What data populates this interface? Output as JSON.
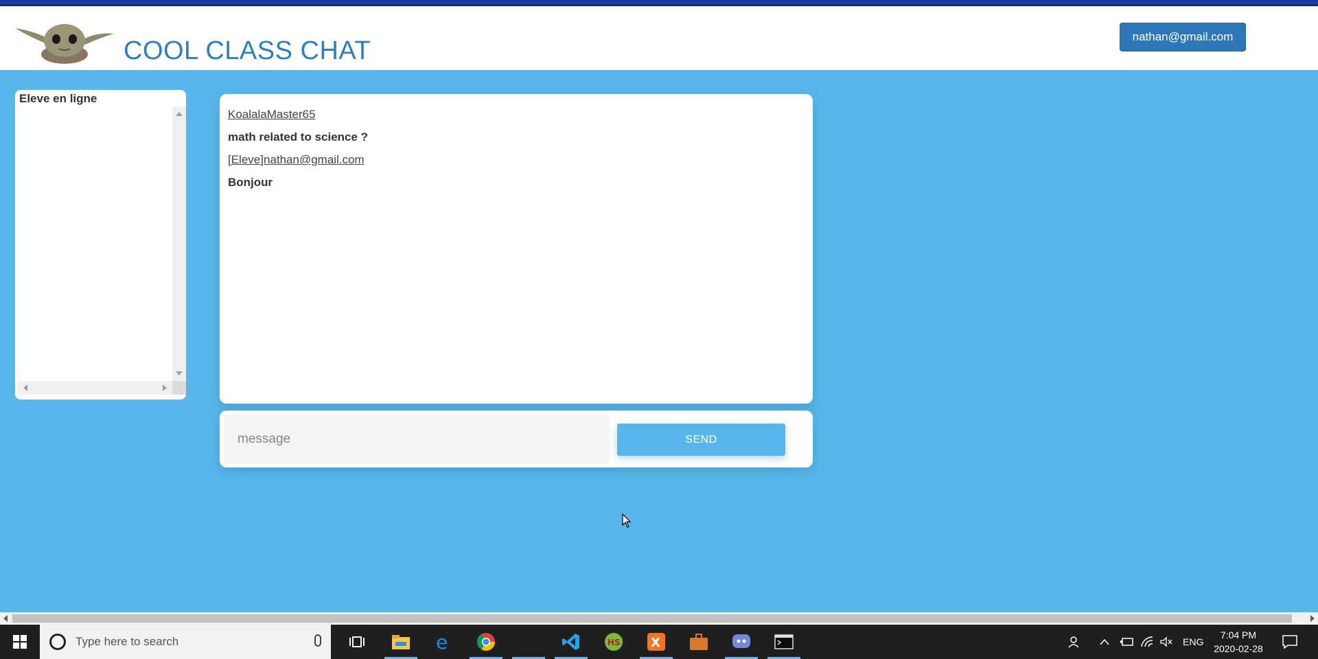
{
  "app": {
    "title": "COOL CLASS CHAT",
    "user_email": "nathan@gmail.com"
  },
  "online_panel": {
    "title": "Eleve en ligne",
    "students": []
  },
  "messages": [
    {
      "author": "KoalalaMaster65",
      "text": "math related to science ?"
    },
    {
      "author": "[Eleve]nathan@gmail.com",
      "text": "Bonjour"
    }
  ],
  "composer": {
    "placeholder": "message",
    "send_label": "SEND"
  },
  "taskbar": {
    "search_placeholder": "Type here to search",
    "language": "ENG",
    "time": "7:04 PM",
    "date": "2020-02-28",
    "apps": [
      "file-explorer",
      "edge",
      "chrome",
      "vscode",
      "hs-app",
      "xampp",
      "briefcase",
      "discord",
      "terminal"
    ]
  },
  "colors": {
    "page_bg": "#58b7ea",
    "title_blue": "#2f7fc0",
    "user_button": "#2f78b7",
    "send_button": "#58b7ea"
  }
}
